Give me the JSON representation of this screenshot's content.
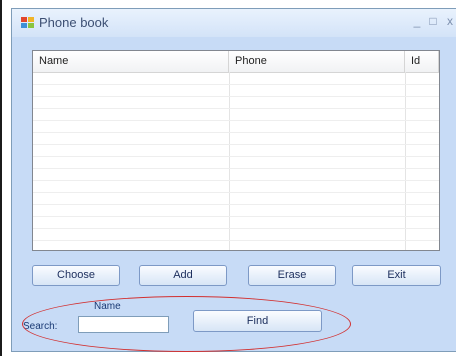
{
  "window": {
    "title": "Phone book",
    "controls": {
      "minimize": "_",
      "maximize": "□",
      "close": "x"
    }
  },
  "grid": {
    "columns": [
      "Name",
      "Phone",
      "Id"
    ],
    "rows": []
  },
  "buttons": {
    "choose": "Choose",
    "add": "Add",
    "erase": "Erase",
    "exit": "Exit",
    "find": "Find"
  },
  "search": {
    "name_label": "Name",
    "search_label": "Search:",
    "value": ""
  },
  "colors": {
    "window_bg": "#c7dbf6",
    "highlight_ellipse": "#d23030"
  }
}
